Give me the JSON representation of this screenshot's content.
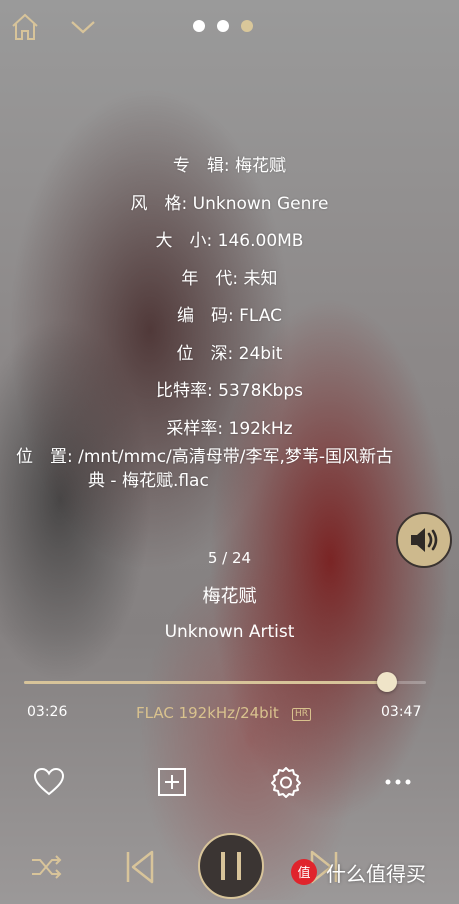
{
  "topbar": {
    "home_icon": "home-icon",
    "collapse_icon": "chevron-down-icon",
    "pages": 3,
    "active_page": 3
  },
  "info": {
    "album": "专　辑: 梅花赋",
    "genre": "风　格: Unknown Genre",
    "size": "大　小: 146.00MB",
    "year": "年　代: 未知",
    "codec": "编　码: FLAC",
    "depth": "位　深: 24bit",
    "bitrate": "比特率: 5378Kbps",
    "samplerate": "采样率: 192kHz",
    "path_line1": "位　置: /mnt/mmc/高清母带/李军,梦苇-国风新古",
    "path_line2": "典 - 梅花赋.flac"
  },
  "track": {
    "index": "5 / 24",
    "title": "梅花赋",
    "artist": "Unknown Artist"
  },
  "playback": {
    "elapsed": "03:26",
    "total": "03:47",
    "progress": 0.904,
    "format": "FLAC 192kHz/24bit",
    "hr_badge": "HR"
  },
  "actions": [
    "heart-icon",
    "add-to-playlist-icon",
    "settings-icon",
    "more-icon"
  ],
  "controls": [
    "shuffle-icon",
    "previous-icon",
    "pause-icon",
    "next-icon"
  ],
  "watermark": {
    "text": "什么值得买"
  },
  "colors": {
    "accent": "#d9c28e",
    "volume_button": "#cdb98d"
  }
}
